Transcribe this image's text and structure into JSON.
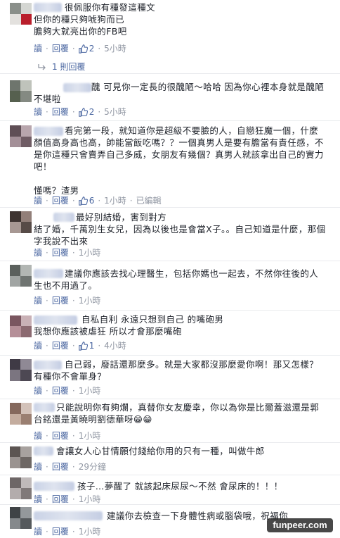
{
  "labels": {
    "reply": "讀",
    "reply2": "回覆",
    "edited": "已編輯",
    "dot": "·"
  },
  "colors": {
    "link": "#4b67a1",
    "meta": "#9197a3",
    "text": "#1d2129",
    "watermark_bg": "#282828"
  },
  "icons": {
    "like": "thumbs-up-icon",
    "reply_arrow": "reply-arrow-icon"
  },
  "comments": [
    {
      "id": "c1",
      "text": "很佩服你有種發這種文\n但你的種只夠唬狗而已\n膽夠大就亮出你的FB吧",
      "likes": "2",
      "time": "5小時"
    },
    {
      "id": "c2",
      "text": "醜 可見你一定長的很醜陋～哈哈 因為你心裡本身就是醜陋不堪啦",
      "likes": "2",
      "time": "5小時"
    },
    {
      "id": "c3",
      "text": "看完第一段，就知道你是超級不要臉的人，自戀狂魔一個，什麼顏值高身高也高，帥能當飯吃嗎？？一個真男人是要有膽當有責任感，不是你這種只會賣弄自己多威，女朋友有幾個？真男人就該拿出自己的實力吧！\n\n懂嗎？渣男",
      "likes": "6",
      "time": "1小時"
    },
    {
      "id": "c4",
      "text": "最好別結婚，害到對方\n結了婚，千萬別生女兒，因為以後也是會當X子。。自己知道是什麼，那個字我說不出來",
      "time": "1小時"
    },
    {
      "id": "c5",
      "text": "建議你應該去找心理醫生，包括你媽也一起去，不然你往後的人生也不用過了。",
      "time": "1小時"
    },
    {
      "id": "c6",
      "text": "自私自利 永遠只想到自己 的嘴砲男\n我想你應該被虐狂 所以才會那麼嘴砲",
      "likes": "1",
      "time": "4小時"
    },
    {
      "id": "c7",
      "text": "自己弱，廢話還那麼多。就是大家都沒那麼愛你啊！那又怎樣？有種你不會單身？",
      "time": "1小時"
    },
    {
      "id": "c8",
      "text": "只能說明你有夠爛，真替你女友慶幸，你以為你是比爾蓋滋還是郭台銘還是黃曉明劉德華呀😁😁",
      "time": "1小時"
    },
    {
      "id": "c9",
      "text": "會讓女人心甘情願付錢給你用的只有一種，叫做牛郎",
      "time": "29分鐘"
    },
    {
      "id": "c10",
      "text": "孩子…夢醒了 就該起床尿尿～不然 會尿床的！！！",
      "time": "1小時"
    },
    {
      "id": "c11",
      "text": "建議你去檢查一下身體性病或腦袋哦，祝福你",
      "time": "1小時"
    }
  ],
  "thread": {
    "reply_count_label": "1 則回覆"
  },
  "watermark": "funpeer.com"
}
